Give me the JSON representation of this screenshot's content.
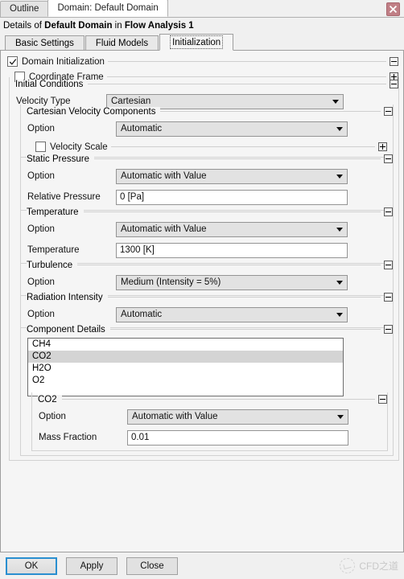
{
  "window": {
    "tabs": [
      {
        "label": "Outline",
        "active": false
      },
      {
        "label": "Domain: Default Domain",
        "active": true
      }
    ],
    "close_label": "close-window"
  },
  "details_header": {
    "prefix": "Details of ",
    "object": "Default Domain",
    "middle": " in ",
    "analysis": "Flow Analysis 1"
  },
  "inner_tabs": [
    {
      "label": "Basic Settings",
      "active": false
    },
    {
      "label": "Fluid Models",
      "active": false
    },
    {
      "label": "Initialization",
      "active": true
    }
  ],
  "form": {
    "domain_initialization": {
      "label": "Domain Initialization",
      "checked": true,
      "expander": "minus"
    },
    "coordinate_frame": {
      "label": "Coordinate Frame",
      "checked": false,
      "expander": "plus"
    },
    "initial_conditions": {
      "label": "Initial Conditions",
      "expander": "minus"
    },
    "velocity_type": {
      "label": "Velocity Type",
      "value": "Cartesian"
    },
    "cartesian_velocity_components": {
      "label": "Cartesian Velocity Components",
      "expander": "minus",
      "option_label": "Option",
      "option_value": "Automatic",
      "velocity_scale": {
        "label": "Velocity Scale",
        "checked": false,
        "expander": "plus"
      }
    },
    "static_pressure": {
      "label": "Static Pressure",
      "expander": "minus",
      "option_label": "Option",
      "option_value": "Automatic with Value",
      "relative_pressure_label": "Relative Pressure",
      "relative_pressure_value": "0 [Pa]"
    },
    "temperature": {
      "label": "Temperature",
      "expander": "minus",
      "option_label": "Option",
      "option_value": "Automatic with Value",
      "temperature_label": "Temperature",
      "temperature_value": "1300 [K]"
    },
    "turbulence": {
      "label": "Turbulence",
      "expander": "minus",
      "option_label": "Option",
      "option_value": "Medium (Intensity = 5%)"
    },
    "radiation_intensity": {
      "label": "Radiation Intensity",
      "expander": "minus",
      "option_label": "Option",
      "option_value": "Automatic"
    },
    "component_details": {
      "label": "Component Details",
      "expander": "minus",
      "items": [
        {
          "name": "CH4",
          "selected": false
        },
        {
          "name": "CO2",
          "selected": true
        },
        {
          "name": "H2O",
          "selected": false
        },
        {
          "name": "O2",
          "selected": false
        }
      ]
    },
    "component_co2": {
      "label": "CO2",
      "expander": "minus",
      "option_label": "Option",
      "option_value": "Automatic with Value",
      "mass_fraction_label": "Mass Fraction",
      "mass_fraction_value": "0.01"
    }
  },
  "footer": {
    "ok_label": "OK",
    "apply_label": "Apply",
    "close_label": "Close",
    "watermark_text": "CFD之道"
  },
  "colors": {
    "accent_focus": "#2a8fd0",
    "close_button": "#c07f86",
    "selection": "#d4d4d4",
    "panel_bg": "#f5f5f5",
    "combo_bg": "#e2e2e2"
  }
}
